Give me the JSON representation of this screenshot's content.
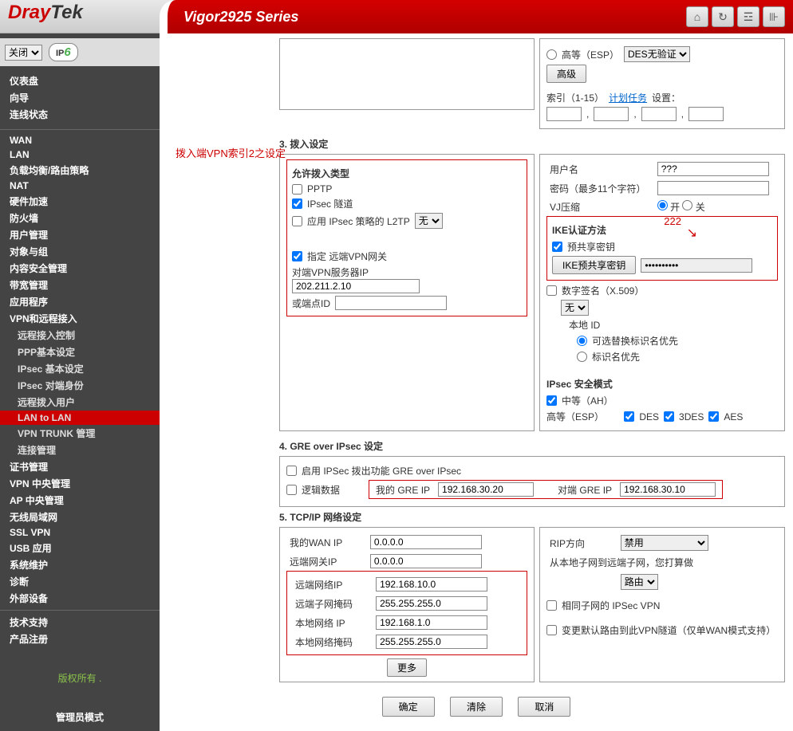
{
  "brand": {
    "d": "Dray",
    "rest": "Tek",
    "series_prefix": "Vigor",
    "series_num": "2925",
    "series_suffix": " Series"
  },
  "sidebar": {
    "dropdown": "关闭",
    "ipv6_label": "IP",
    "groups": {
      "g1": [
        "仪表盘",
        "向导",
        "连线状态"
      ],
      "g2": [
        "WAN",
        "LAN",
        "负载均衡/路由策略",
        "NAT",
        "硬件加速",
        "防火墙",
        "用户管理",
        "对象与组",
        "内容安全管理",
        "带宽管理",
        "应用程序",
        "VPN和远程接入"
      ],
      "sub": [
        "远程接入控制",
        "PPP基本设定",
        "IPsec 基本设定",
        "IPsec 对端身份",
        "远程拨入用户",
        "LAN to LAN",
        "VPN TRUNK 管理",
        "连接管理"
      ],
      "g3": [
        "证书管理",
        "VPN 中央管理",
        "AP 中央管理",
        "无线局域网",
        "SSL VPN",
        "USB 应用",
        "系统维护",
        "诊断",
        "外部设备"
      ],
      "g4": [
        "技术支持",
        "产品注册"
      ],
      "admin": "管理员模式"
    },
    "copyright": "版权所有 ."
  },
  "annot": {
    "dialin": "拨入端VPN索引2之设定",
    "psk": "222"
  },
  "dialout_top": {
    "high_label": "高等（ESP）",
    "des_select": "DES无验证",
    "adv_btn": "高级",
    "index_label": "索引（1-15）",
    "schedule_link": "计划任务",
    "schedule_suffix": " 设置："
  },
  "section3": {
    "title": "3. 拨入设定",
    "allow_title": "允许拨入类型",
    "pptp": "PPTP",
    "ipsec": "IPsec 隧道",
    "l2tp": "应用 IPsec 策略的 L2TP",
    "l2tp_select": "无",
    "remote_gw": "指定 远端VPN网关",
    "peer_ip_label": "对端VPN服务器IP",
    "peer_ip_value": "202.211.2.10",
    "peer_id_label": "或端点ID",
    "peer_id_value": "",
    "user_label": "用户名",
    "user_value": "???",
    "pwd_label": "密码（最多11个字符）",
    "pwd_value": "",
    "vj_label": "VJ压缩",
    "vj_on": "开",
    "vj_off": "关",
    "ike_title": "IKE认证方法",
    "psk_check": "预共享密钥",
    "psk_btn": "IKE预共享密钥",
    "psk_value": "••••••••••",
    "x509_label": "数字签名（X.509）",
    "x509_select": "无",
    "local_id": "本地 ID",
    "alt_subj": "可选替换标识名优先",
    "subj": "标识名优先",
    "ipsec_sec_title": "IPsec 安全模式",
    "ah": "中等（AH）",
    "esp": "高等（ESP）",
    "des": "DES",
    "tdes": "3DES",
    "aes": "AES"
  },
  "section4": {
    "title": "4. GRE over IPsec 设定",
    "enable": "启用 IPSec 拨出功能 GRE over IPsec",
    "logic": "逻辑数据",
    "mygre_label": "我的 GRE IP",
    "mygre_value": "192.168.30.20",
    "peergre_label": "对端 GRE IP",
    "peergre_value": "192.168.30.10"
  },
  "section5": {
    "title": "5. TCP/IP 网络设定",
    "mywan": "我的WAN IP",
    "mywan_v": "0.0.0.0",
    "remotegw": "远端网关IP",
    "remotegw_v": "0.0.0.0",
    "remotenet": "远端网络IP",
    "remotenet_v": "192.168.10.0",
    "remotemask": "远端子网掩码",
    "remotemask_v": "255.255.255.0",
    "localnet": "本地网络 IP",
    "localnet_v": "192.168.1.0",
    "localmask": "本地网络掩码",
    "localmask_v": "255.255.255.0",
    "more_btn": "更多",
    "rip_label": "RIP方向",
    "rip_v": "禁用",
    "fromto": "从本地子网到远端子网，您打算做",
    "route_v": "路由",
    "same_subnet": "相同子网的 IPSec VPN",
    "change_default": "变更默认路由到此VPN隧道（仅单WAN模式支持）"
  },
  "buttons": {
    "ok": "确定",
    "clear": "清除",
    "cancel": "取消"
  }
}
